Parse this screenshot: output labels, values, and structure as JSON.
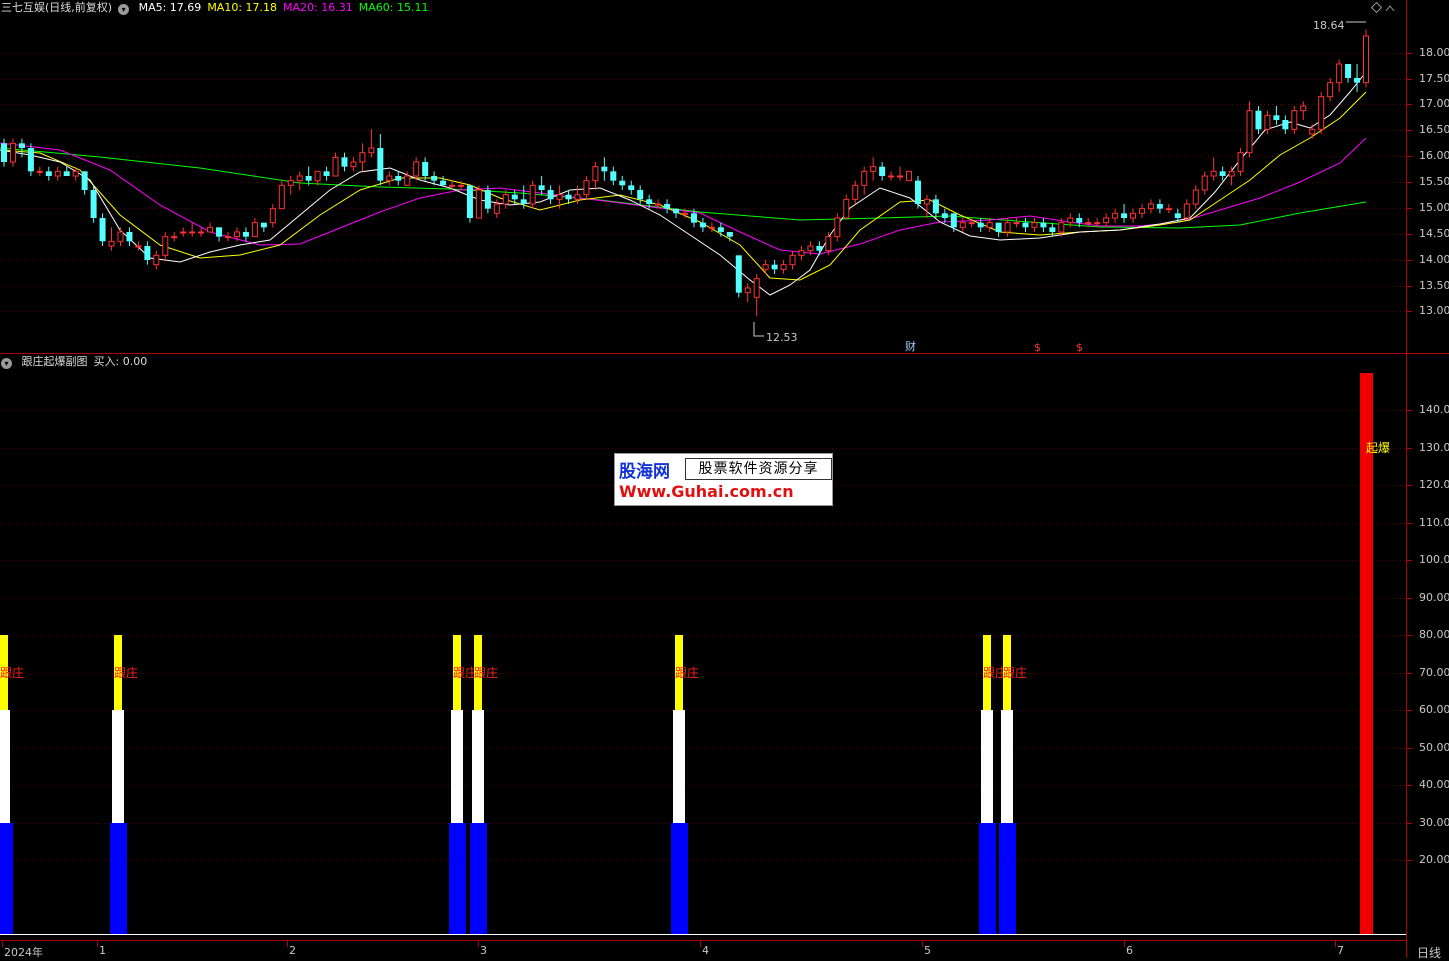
{
  "header": {
    "stock": "三七互娱(日线,前复权)",
    "ma": [
      {
        "label": "MA5: 17.69",
        "color": "#ffffff"
      },
      {
        "label": "MA10: 17.18",
        "color": "#ffff00"
      },
      {
        "label": "MA20: 16.31",
        "color": "#ff00ff"
      },
      {
        "label": "MA60: 15.11",
        "color": "#00ff00"
      }
    ]
  },
  "price_axis": [
    "18.00",
    "17.50",
    "17.00",
    "16.50",
    "16.00",
    "15.50",
    "15.00",
    "14.50",
    "14.00",
    "13.50",
    "13.00"
  ],
  "price_annotations": {
    "high": "18.64",
    "low": "12.53"
  },
  "event_markers": [
    {
      "label": "财",
      "color": "#a0c8ff"
    },
    {
      "label": "$",
      "color": "#ff3030"
    },
    {
      "label": "$",
      "color": "#ff3030"
    }
  ],
  "sub_panel": {
    "title": "跟庄起爆副图",
    "value": "买入: 0.00",
    "axis": [
      "140.00",
      "130.00",
      "120.00",
      "110.00",
      "100.00",
      "90.00",
      "80.00",
      "70.00",
      "60.00",
      "50.00",
      "40.00",
      "30.00",
      "20.00"
    ],
    "signal_label": "跟庄",
    "burst_label": "起爆"
  },
  "watermark": {
    "name": "股海网",
    "slogan": "股票软件资源分享",
    "url": "Www.Guhai.com.cn"
  },
  "time_axis": [
    "2024年",
    "1",
    "2",
    "3",
    "4",
    "5",
    "6",
    "7"
  ],
  "period_button": "日线",
  "colors": {
    "up": "#ff3232",
    "down": "#54ffff",
    "divider": "#b00000",
    "grid": "#5a0000"
  },
  "chart_data": {
    "type": "candlestick",
    "ylim": [
      12.5,
      18.8
    ],
    "ohlc": [
      [
        16.2,
        16.3,
        15.7,
        15.8
      ],
      [
        15.8,
        16.3,
        15.7,
        16.2
      ],
      [
        16.2,
        16.3,
        15.9,
        16.1
      ],
      [
        16.1,
        16.2,
        15.5,
        15.6
      ],
      [
        15.6,
        15.7,
        15.5,
        15.6
      ],
      [
        15.6,
        15.7,
        15.4,
        15.5
      ],
      [
        15.5,
        15.7,
        15.4,
        15.6
      ],
      [
        15.6,
        15.7,
        15.5,
        15.5
      ],
      [
        15.5,
        15.7,
        15.4,
        15.6
      ],
      [
        15.6,
        15.6,
        15.1,
        15.2
      ],
      [
        15.2,
        15.3,
        14.5,
        14.6
      ],
      [
        14.6,
        14.7,
        14.0,
        14.1
      ],
      [
        14.0,
        14.4,
        13.9,
        14.1
      ],
      [
        14.1,
        14.4,
        14.0,
        14.3
      ],
      [
        14.3,
        14.4,
        14.0,
        14.1
      ],
      [
        14.0,
        14.1,
        13.9,
        14.0
      ],
      [
        14.0,
        14.1,
        13.6,
        13.7
      ],
      [
        13.6,
        13.9,
        13.5,
        13.8
      ],
      [
        13.8,
        14.3,
        13.7,
        14.2
      ],
      [
        14.2,
        14.3,
        14.1,
        14.2
      ],
      [
        14.3,
        14.4,
        14.2,
        14.3
      ],
      [
        14.3,
        14.5,
        14.2,
        14.3
      ],
      [
        14.3,
        14.4,
        14.2,
        14.3
      ],
      [
        14.3,
        14.5,
        14.3,
        14.4
      ],
      [
        14.4,
        14.4,
        14.1,
        14.2
      ],
      [
        14.2,
        14.3,
        14.1,
        14.2
      ],
      [
        14.2,
        14.4,
        14.1,
        14.3
      ],
      [
        14.3,
        14.4,
        14.1,
        14.2
      ],
      [
        14.2,
        14.6,
        14.2,
        14.5
      ],
      [
        14.5,
        14.5,
        14.3,
        14.4
      ],
      [
        14.5,
        14.9,
        14.4,
        14.8
      ],
      [
        14.8,
        15.4,
        14.8,
        15.3
      ],
      [
        15.3,
        15.5,
        15.1,
        15.4
      ],
      [
        15.4,
        15.6,
        15.2,
        15.5
      ],
      [
        15.5,
        15.7,
        15.3,
        15.4
      ],
      [
        15.4,
        15.6,
        15.3,
        15.6
      ],
      [
        15.6,
        15.7,
        15.4,
        15.5
      ],
      [
        15.5,
        16.0,
        15.5,
        15.9
      ],
      [
        15.9,
        16.0,
        15.6,
        15.7
      ],
      [
        15.7,
        15.9,
        15.6,
        15.8
      ],
      [
        15.8,
        16.2,
        15.6,
        16.0
      ],
      [
        16.0,
        16.5,
        15.9,
        16.1
      ],
      [
        16.1,
        16.4,
        15.3,
        15.4
      ],
      [
        15.4,
        15.6,
        15.3,
        15.5
      ],
      [
        15.5,
        15.6,
        15.3,
        15.4
      ],
      [
        15.3,
        15.6,
        15.3,
        15.5
      ],
      [
        15.5,
        15.9,
        15.4,
        15.8
      ],
      [
        15.8,
        15.9,
        15.4,
        15.5
      ],
      [
        15.5,
        15.6,
        15.3,
        15.4
      ],
      [
        15.4,
        15.5,
        15.3,
        15.3
      ],
      [
        15.3,
        15.4,
        15.2,
        15.3
      ],
      [
        15.3,
        15.4,
        15.2,
        15.3
      ],
      [
        15.3,
        15.3,
        14.5,
        14.6
      ],
      [
        14.6,
        15.3,
        14.6,
        15.2
      ],
      [
        15.2,
        15.3,
        14.7,
        14.8
      ],
      [
        14.7,
        15.0,
        14.6,
        14.9
      ],
      [
        14.9,
        15.2,
        14.8,
        15.1
      ],
      [
        15.1,
        15.2,
        14.9,
        15.0
      ],
      [
        15.0,
        15.3,
        14.8,
        14.9
      ],
      [
        14.9,
        15.4,
        14.8,
        15.3
      ],
      [
        15.3,
        15.5,
        15.1,
        15.2
      ],
      [
        15.2,
        15.3,
        14.9,
        15.0
      ],
      [
        15.0,
        15.3,
        14.8,
        15.1
      ],
      [
        15.1,
        15.2,
        14.9,
        15.0
      ],
      [
        15.0,
        15.3,
        14.9,
        15.1
      ],
      [
        15.1,
        15.5,
        15.0,
        15.4
      ],
      [
        15.4,
        15.8,
        15.2,
        15.7
      ],
      [
        15.7,
        15.9,
        15.4,
        15.6
      ],
      [
        15.6,
        15.7,
        15.3,
        15.4
      ],
      [
        15.4,
        15.5,
        15.2,
        15.3
      ],
      [
        15.3,
        15.4,
        15.1,
        15.2
      ],
      [
        15.2,
        15.3,
        14.9,
        15.0
      ],
      [
        15.0,
        15.1,
        14.8,
        14.9
      ],
      [
        14.9,
        15.0,
        14.8,
        14.9
      ],
      [
        14.9,
        15.0,
        14.7,
        14.8
      ],
      [
        14.8,
        14.8,
        14.6,
        14.7
      ],
      [
        14.7,
        14.8,
        14.6,
        14.7
      ],
      [
        14.7,
        14.8,
        14.4,
        14.5
      ],
      [
        14.5,
        14.6,
        14.3,
        14.4
      ],
      [
        14.4,
        14.5,
        14.3,
        14.4
      ],
      [
        14.4,
        14.5,
        14.2,
        14.3
      ],
      [
        14.3,
        14.3,
        14.1,
        14.2
      ],
      [
        13.8,
        13.8,
        12.9,
        13.0
      ],
      [
        13.0,
        13.2,
        12.8,
        13.1
      ],
      [
        12.9,
        13.4,
        12.5,
        13.3
      ],
      [
        13.5,
        13.7,
        13.4,
        13.6
      ],
      [
        13.6,
        13.7,
        13.4,
        13.5
      ],
      [
        13.5,
        13.7,
        13.4,
        13.6
      ],
      [
        13.6,
        13.9,
        13.5,
        13.8
      ],
      [
        13.8,
        14.0,
        13.7,
        13.9
      ],
      [
        13.9,
        14.1,
        13.8,
        14.0
      ],
      [
        14.0,
        14.1,
        13.8,
        13.9
      ],
      [
        13.9,
        14.3,
        13.8,
        14.2
      ],
      [
        14.2,
        14.7,
        14.1,
        14.6
      ],
      [
        14.6,
        15.1,
        14.6,
        15.0
      ],
      [
        15.0,
        15.4,
        14.9,
        15.3
      ],
      [
        15.3,
        15.7,
        15.1,
        15.6
      ],
      [
        15.6,
        15.9,
        15.4,
        15.7
      ],
      [
        15.7,
        15.8,
        15.4,
        15.5
      ],
      [
        15.5,
        15.6,
        15.4,
        15.5
      ],
      [
        15.5,
        15.7,
        15.4,
        15.5
      ],
      [
        15.4,
        15.6,
        15.4,
        15.6
      ],
      [
        15.4,
        15.5,
        14.8,
        14.9
      ],
      [
        14.9,
        15.1,
        14.6,
        15.0
      ],
      [
        15.0,
        15.1,
        14.6,
        14.7
      ],
      [
        14.7,
        14.8,
        14.5,
        14.6
      ],
      [
        14.7,
        14.7,
        14.3,
        14.4
      ],
      [
        14.4,
        14.6,
        14.3,
        14.5
      ],
      [
        14.5,
        14.6,
        14.4,
        14.5
      ],
      [
        14.5,
        14.6,
        14.3,
        14.4
      ],
      [
        14.4,
        14.6,
        14.3,
        14.5
      ],
      [
        14.5,
        14.5,
        14.2,
        14.3
      ],
      [
        14.3,
        14.6,
        14.2,
        14.5
      ],
      [
        14.5,
        14.6,
        14.4,
        14.5
      ],
      [
        14.5,
        14.6,
        14.3,
        14.4
      ],
      [
        14.4,
        14.6,
        14.3,
        14.5
      ],
      [
        14.5,
        14.6,
        14.3,
        14.4
      ],
      [
        14.4,
        14.5,
        14.2,
        14.3
      ],
      [
        14.3,
        14.6,
        14.2,
        14.5
      ],
      [
        14.5,
        14.7,
        14.4,
        14.6
      ],
      [
        14.6,
        14.7,
        14.4,
        14.5
      ],
      [
        14.5,
        14.6,
        14.4,
        14.5
      ],
      [
        14.5,
        14.6,
        14.4,
        14.5
      ],
      [
        14.5,
        14.7,
        14.4,
        14.6
      ],
      [
        14.6,
        14.8,
        14.5,
        14.7
      ],
      [
        14.7,
        14.9,
        14.5,
        14.6
      ],
      [
        14.6,
        14.8,
        14.5,
        14.7
      ],
      [
        14.7,
        14.9,
        14.6,
        14.8
      ],
      [
        14.8,
        15.0,
        14.7,
        14.9
      ],
      [
        14.9,
        15.0,
        14.7,
        14.8
      ],
      [
        14.8,
        14.9,
        14.7,
        14.8
      ],
      [
        14.7,
        14.8,
        14.5,
        14.6
      ],
      [
        14.6,
        15.0,
        14.6,
        14.9
      ],
      [
        14.9,
        15.3,
        14.8,
        15.2
      ],
      [
        15.2,
        15.6,
        15.1,
        15.5
      ],
      [
        15.5,
        15.9,
        15.4,
        15.6
      ],
      [
        15.6,
        15.7,
        15.4,
        15.5
      ],
      [
        15.5,
        15.7,
        15.3,
        15.6
      ],
      [
        15.6,
        16.1,
        15.5,
        16.0
      ],
      [
        16.0,
        17.1,
        15.9,
        16.9
      ],
      [
        16.9,
        17.0,
        16.4,
        16.5
      ],
      [
        16.5,
        16.9,
        16.4,
        16.8
      ],
      [
        16.8,
        17.0,
        16.6,
        16.7
      ],
      [
        16.7,
        16.8,
        16.4,
        16.5
      ],
      [
        16.5,
        17.0,
        16.4,
        16.9
      ],
      [
        16.9,
        17.1,
        16.7,
        17.0
      ],
      [
        16.4,
        16.6,
        16.3,
        16.5
      ],
      [
        16.5,
        17.3,
        16.4,
        17.2
      ],
      [
        17.2,
        17.6,
        17.1,
        17.5
      ],
      [
        17.5,
        18.0,
        17.3,
        17.9
      ],
      [
        17.9,
        17.9,
        17.5,
        17.6
      ],
      [
        17.6,
        17.9,
        17.3,
        17.5
      ],
      [
        17.5,
        18.64,
        17.4,
        18.5
      ]
    ]
  }
}
